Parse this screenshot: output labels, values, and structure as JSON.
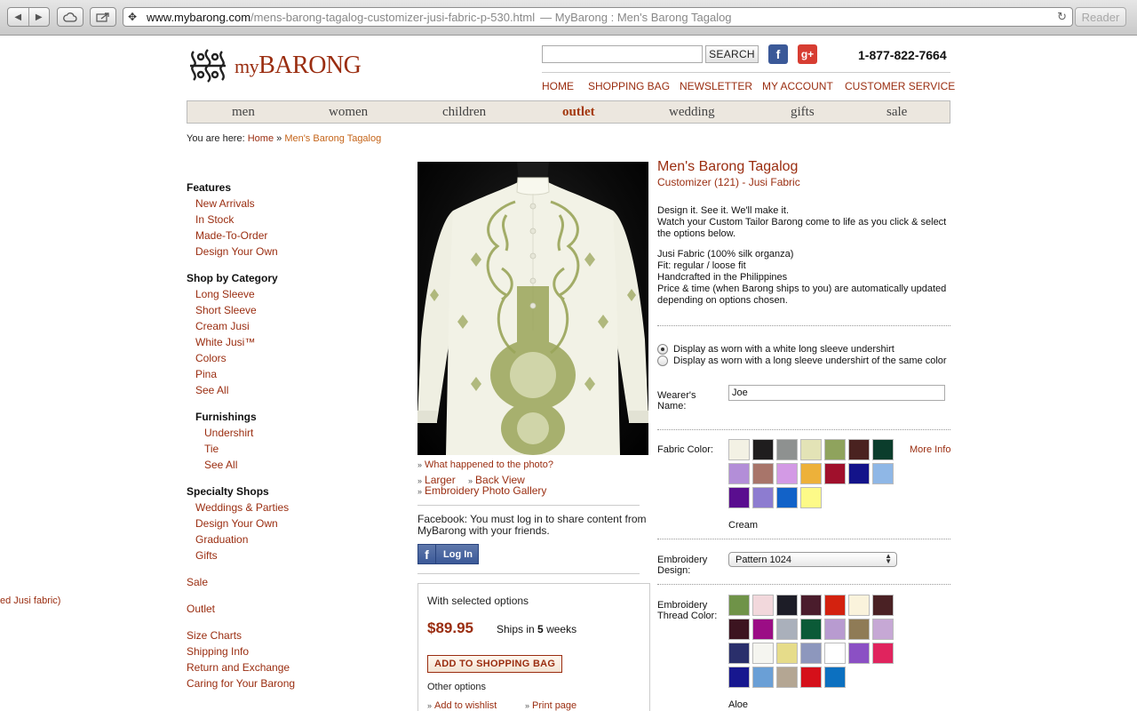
{
  "browser": {
    "url_host": "www.mybarong.com",
    "url_path": "/mens-barong-tagalog-customizer-jusi-fabric-p-530.html",
    "title_suffix": "— MyBarong : Men's Barong Tagalog",
    "reader_label": "Reader"
  },
  "header": {
    "logo_text_my": "my",
    "logo_text_barong": "BARONG",
    "search_button": "SEARCH",
    "search_value": "",
    "phone": "1-877-822-7664",
    "top_links": [
      "HOME",
      "SHOPPING BAG",
      "NEWSLETTER",
      "MY ACCOUNT",
      "CUSTOMER SERVICE"
    ]
  },
  "nav": [
    "men",
    "women",
    "children",
    "outlet",
    "wedding",
    "gifts",
    "sale"
  ],
  "nav_active": "outlet",
  "breadcrumb": {
    "prefix": "You are here:",
    "home": "Home",
    "sep": "»",
    "current": "Men's Barong Tagalog"
  },
  "sidebar": {
    "features_head": "Features",
    "features": [
      "New Arrivals",
      "In Stock",
      "Made-To-Order",
      "Design Your Own"
    ],
    "category_head": "Shop by Category",
    "categories": [
      "Long Sleeve",
      "Short Sleeve",
      "Cream Jusi",
      "White Jusi™",
      "Colors",
      "Pina",
      "See All"
    ],
    "furnishings_head": "Furnishings",
    "furnishings": [
      "Undershirt",
      "Tie",
      "See All"
    ],
    "specialty_head": "Specialty Shops",
    "specialty": [
      "Weddings & Parties",
      "Design Your Own",
      "Graduation",
      "Gifts"
    ],
    "sale": "Sale",
    "outlet": "Outlet",
    "info_links": [
      "Size Charts",
      "Shipping Info",
      "Return and Exchange",
      "Caring for Your Barong"
    ],
    "offscreen_fragment": "ed Jusi fabric)"
  },
  "image_links": {
    "what_happened": "What happened to the photo?",
    "larger": "Larger",
    "back_view": "Back View",
    "gallery": "Embroidery Photo Gallery"
  },
  "facebook": {
    "share_text": "Facebook: You must log in to share content from MyBarong with your friends.",
    "login_label": "Log In"
  },
  "buybox": {
    "label": "With selected options",
    "price": "$89.95",
    "ships_prefix": "Ships in",
    "ships_weeks": "5",
    "ships_suffix": "weeks",
    "add_to_bag": "ADD TO SHOPPING BAG",
    "other_options": "Other options",
    "wishlist": "Add to wishlist",
    "print": "Print page"
  },
  "product": {
    "title": "Men's Barong Tagalog",
    "subtitle": "Customizer (121) - Jusi Fabric",
    "desc1": [
      "Design it. See it. We'll make it.",
      "Watch your Custom Tailor Barong come to life as you click & select the options below."
    ],
    "desc2": [
      "Jusi Fabric (100% silk organza)",
      "Fit: regular / loose fit",
      "Handcrafted in the Philippines",
      "Price & time (when Barong ships to you) are automatically updated depending on options chosen."
    ],
    "undershirt_options": [
      "Display as worn with a white long sleeve undershirt",
      "Display as worn with a long sleeve undershirt of the same color"
    ],
    "undershirt_selected": 0,
    "wearer_label": "Wearer's Name:",
    "wearer_value": "Joe",
    "fabric_label": "Fabric Color:",
    "more_info": "More Info",
    "fabric_colors": [
      "#f3f1e4",
      "#1f1d1e",
      "#8e9190",
      "#e3e3b6",
      "#8fa35d",
      "#4a2220",
      "#0b3d2c",
      "#b38ed8",
      "#a8756a",
      "#d39ae5",
      "#edb13a",
      "#a0102c",
      "#13138a",
      "#8fb7e6",
      "#5a0e8f",
      "#8d7cd0",
      "#1262c8",
      "#fdfa88"
    ],
    "fabric_selected": "Cream",
    "embroidery_label": "Embroidery Design:",
    "embroidery_value": "Pattern 1024",
    "thread_label": "Embroidery Thread Color:",
    "thread_colors": [
      "#6f9348",
      "#f2d8dc",
      "#1d1d27",
      "#4a1c2c",
      "#d3220f",
      "#faf3dc",
      "#4a2124",
      "#3c1420",
      "#9b0d85",
      "#aab0bb",
      "#0b5a37",
      "#b89bd0",
      "#8f7b56",
      "#c6a8d5",
      "#2a2f6b",
      "#f5f5f0",
      "#e6dc8a",
      "#8d97bd",
      "#ffffff",
      "#8b50c4",
      "#e0245e",
      "#17178f",
      "#6a9fd6",
      "#b4a693",
      "#d5101a",
      "#0c70c0"
    ],
    "thread_selected": "Aloe"
  }
}
